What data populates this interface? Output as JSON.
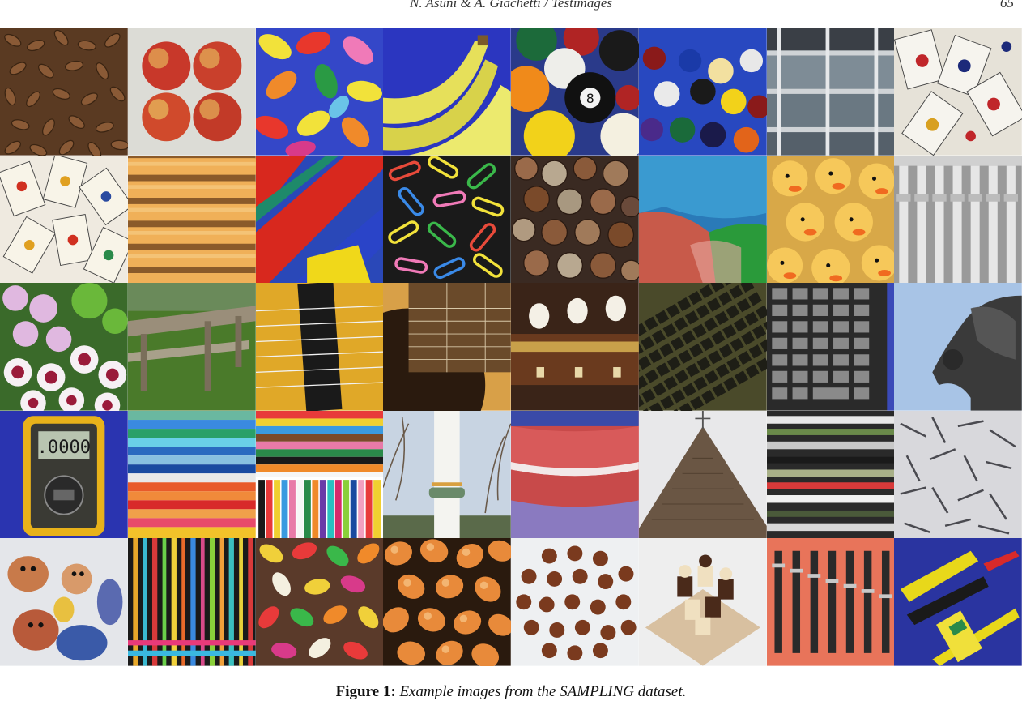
{
  "header": {
    "running_head": "N. Asuni & A. Giachetti / Testimages",
    "page_number": "65"
  },
  "figure": {
    "caption_label": "Figure 1:",
    "caption_text": "Example images from the SAMPLING dataset."
  }
}
